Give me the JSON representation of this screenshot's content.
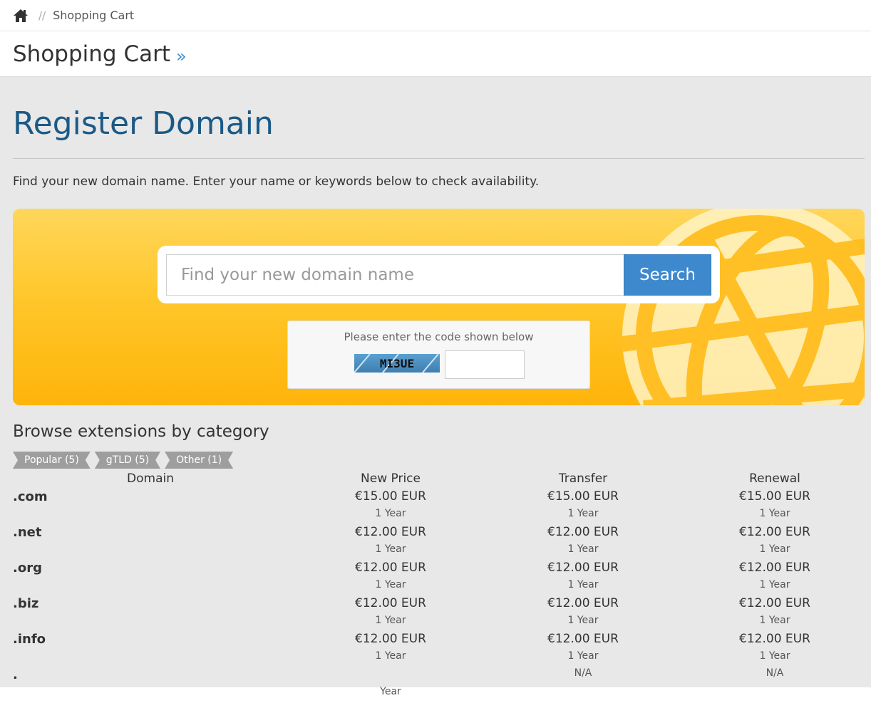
{
  "breadcrumb": {
    "separator": "//",
    "current": "Shopping Cart"
  },
  "header": {
    "title": "Shopping Cart",
    "arrow": "»"
  },
  "main": {
    "heading": "Register Domain",
    "intro": "Find your new domain name. Enter your name or keywords below to check availability."
  },
  "search": {
    "placeholder": "Find your new domain name",
    "button_label": "Search"
  },
  "captcha": {
    "label": "Please enter the code shown below",
    "code": "MI3UE"
  },
  "browse": {
    "title": "Browse extensions by category",
    "tags": [
      "Popular (5)",
      "gTLD (5)",
      "Other (1)"
    ]
  },
  "pricing": {
    "columns": [
      "Domain",
      "New Price",
      "Transfer",
      "Renewal"
    ],
    "rows": [
      {
        "tld": ".com",
        "new_price": "€15.00 EUR",
        "new_period": "1 Year",
        "transfer": "€15.00 EUR",
        "transfer_period": "1 Year",
        "renewal": "€15.00 EUR",
        "renewal_period": "1 Year"
      },
      {
        "tld": ".net",
        "new_price": "€12.00 EUR",
        "new_period": "1 Year",
        "transfer": "€12.00 EUR",
        "transfer_period": "1 Year",
        "renewal": "€12.00 EUR",
        "renewal_period": "1 Year"
      },
      {
        "tld": ".org",
        "new_price": "€12.00 EUR",
        "new_period": "1 Year",
        "transfer": "€12.00 EUR",
        "transfer_period": "1 Year",
        "renewal": "€12.00 EUR",
        "renewal_period": "1 Year"
      },
      {
        "tld": ".biz",
        "new_price": "€12.00 EUR",
        "new_period": "1 Year",
        "transfer": "€12.00 EUR",
        "transfer_period": "1 Year",
        "renewal": "€12.00 EUR",
        "renewal_period": "1 Year"
      },
      {
        "tld": ".info",
        "new_price": "€12.00 EUR",
        "new_period": "1 Year",
        "transfer": "€12.00 EUR",
        "transfer_period": "1 Year",
        "renewal": "€12.00 EUR",
        "renewal_period": "1 Year"
      },
      {
        "tld": ".",
        "new_price": "",
        "new_period": "Year",
        "transfer": "N/A",
        "transfer_period": "",
        "renewal": "N/A",
        "renewal_period": ""
      }
    ]
  },
  "colors": {
    "heading": "#1b5a86",
    "search_button": "#3e89cd",
    "banner_top": "#ffd65a",
    "banner_bottom": "#ffb40a",
    "tag": "#9e9e9e",
    "background": "#e8e8e8"
  },
  "icons": {
    "home": "home-icon",
    "globe": "globe-icon"
  }
}
